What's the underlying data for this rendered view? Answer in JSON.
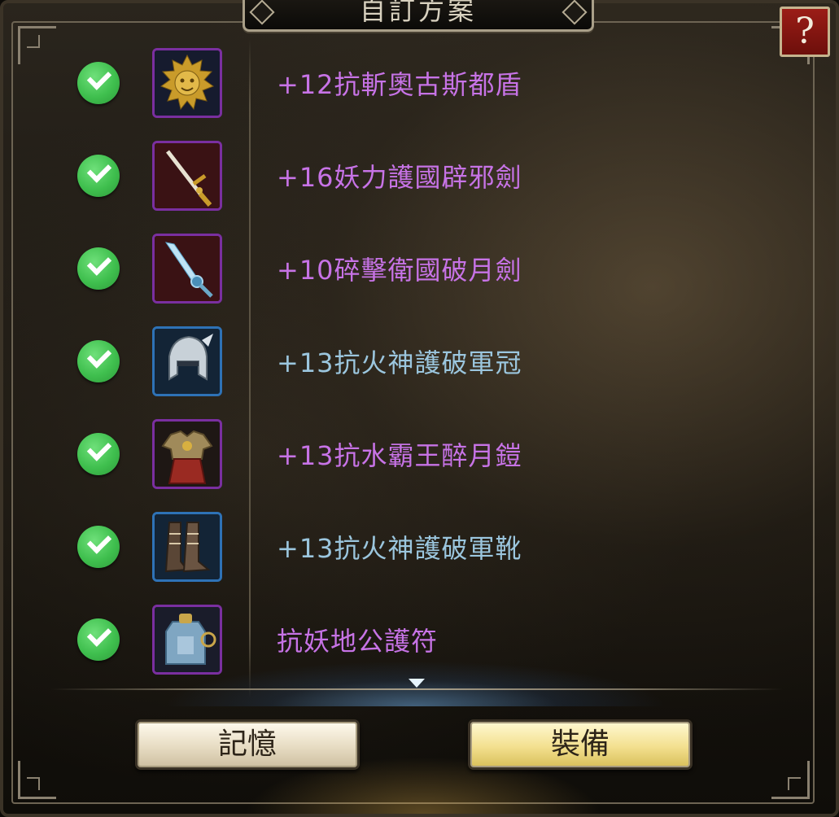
{
  "dialog": {
    "title": "自訂方案",
    "help_label": "?"
  },
  "items": [
    {
      "name": "+12抗斬奧古斯都盾",
      "checked": true,
      "quality": "purple",
      "icon": "golden-lion-shield-icon"
    },
    {
      "name": "+16妖力護國辟邪劍",
      "checked": true,
      "quality": "purple",
      "icon": "golden-sword-icon"
    },
    {
      "name": "+10碎擊衛國破月劍",
      "checked": true,
      "quality": "purple",
      "icon": "ice-sword-icon"
    },
    {
      "name": "+13抗火神護破軍冠",
      "checked": true,
      "quality": "blue",
      "icon": "silver-helmet-icon"
    },
    {
      "name": "+13抗水霸王醉月鎧",
      "checked": true,
      "quality": "purple",
      "icon": "red-armor-icon"
    },
    {
      "name": "+13抗火神護破軍靴",
      "checked": true,
      "quality": "blue",
      "icon": "boots-icon"
    },
    {
      "name": "抗妖地公護符",
      "checked": true,
      "quality": "purple",
      "icon": "talisman-icon"
    }
  ],
  "buttons": {
    "memory": "記憶",
    "equip": "裝備"
  },
  "colors": {
    "purple_text": "#c773e6",
    "blue_text": "#9bc6de",
    "check": "#3fbf4e",
    "help_bg": "#9b1d17"
  }
}
